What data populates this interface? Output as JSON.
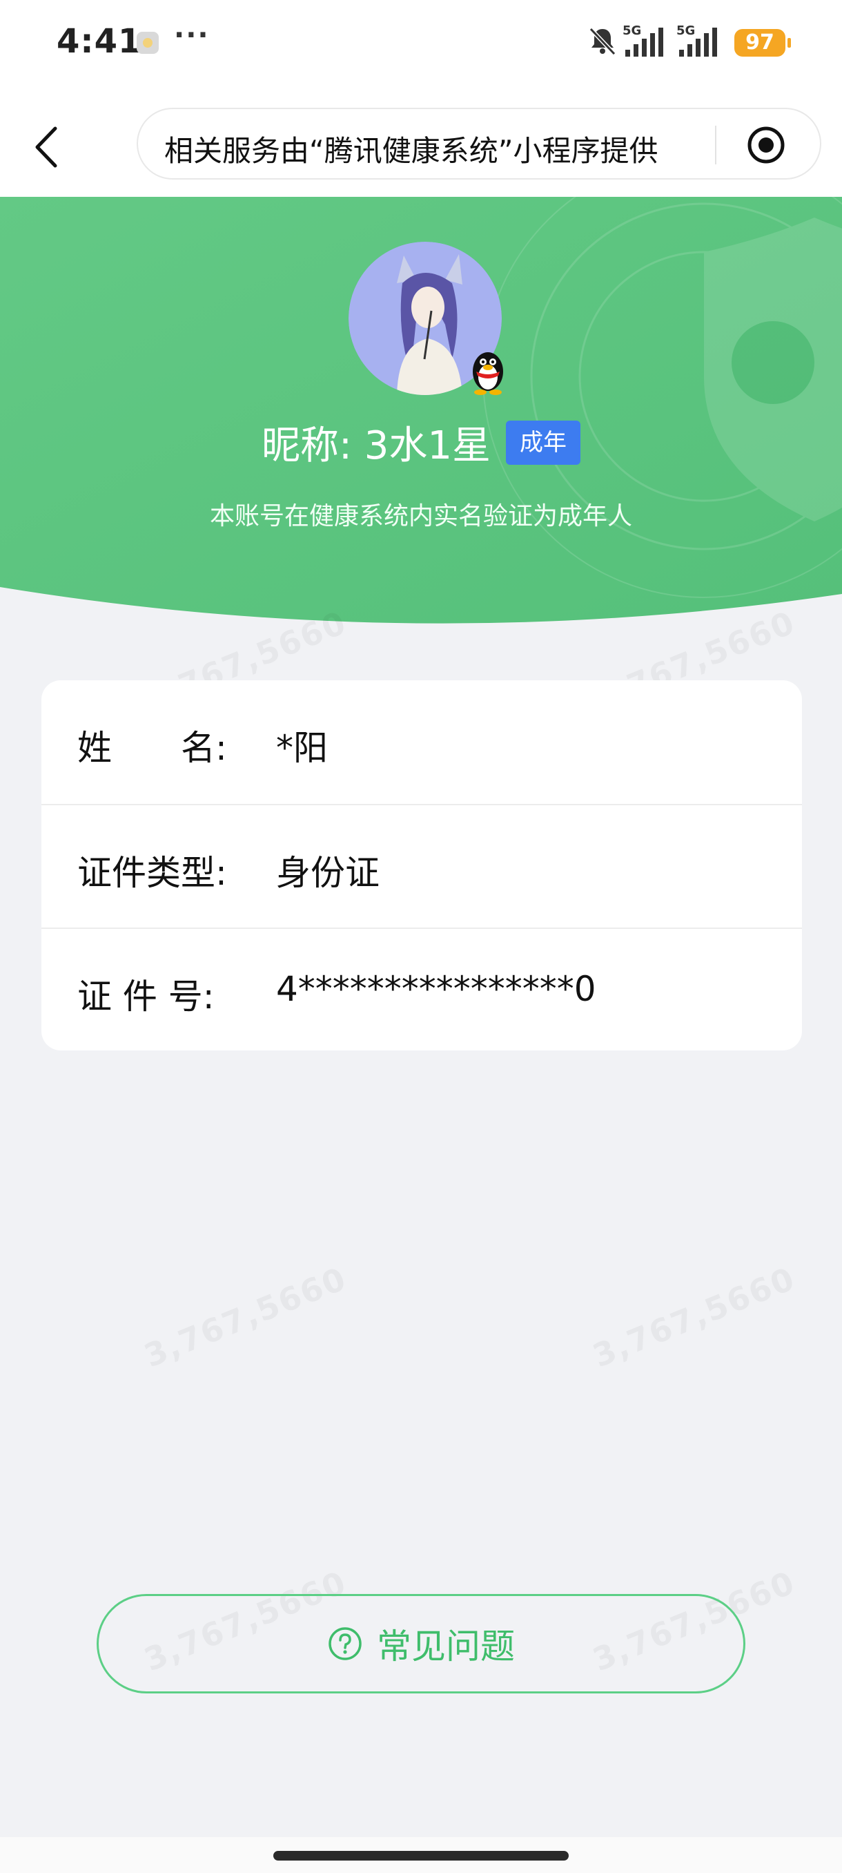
{
  "status_bar": {
    "time": "4:41",
    "more": "···",
    "signal_1_label": "5G",
    "signal_2_label": "5G",
    "battery": "97"
  },
  "nav": {
    "capsule_text": "相关服务由“腾讯健康系统”小程序提供"
  },
  "profile": {
    "nickname": "昵称: 3水1星",
    "badge": "成年",
    "verify_text": "本账号在健康系统内实名验证为成年人"
  },
  "info": {
    "rows": [
      {
        "label": "姓　　名:",
        "value": "*阳"
      },
      {
        "label": "证件类型:",
        "value": "身份证"
      },
      {
        "label": "证 件 号:",
        "value": "4****************0"
      }
    ]
  },
  "watermark": "3,767,5660",
  "faq": {
    "label": "常见问题"
  },
  "colors": {
    "header_green": "#5cc47e",
    "badge_blue": "#3d7cf0",
    "faq_green": "#3fbd6b",
    "battery_orange": "#f5a623"
  }
}
